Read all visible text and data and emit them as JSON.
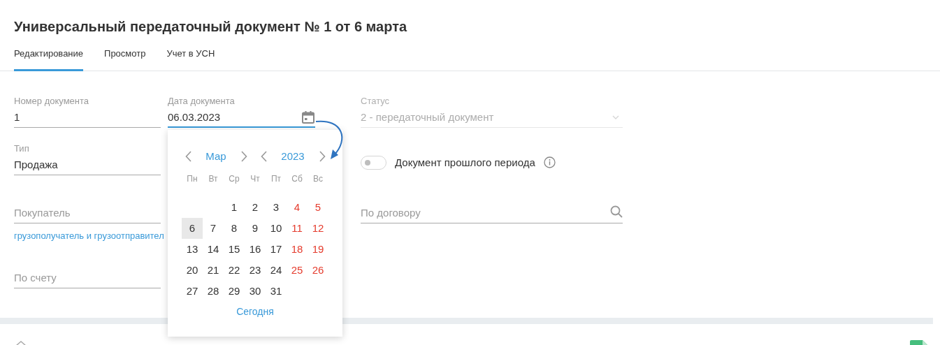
{
  "title": "Универсальный передаточный документ № 1 от 6 марта",
  "tabs": [
    {
      "label": "Редактирование",
      "selected": true
    },
    {
      "label": "Просмотр",
      "selected": false
    },
    {
      "label": "Учет в УСН",
      "selected": false
    }
  ],
  "columns": [
    {
      "fields": [
        {
          "kind": "text",
          "label": "Номер документа",
          "value": "1"
        },
        {
          "kind": "text",
          "label": "Тип",
          "value": "Продажа"
        },
        {
          "kind": "text",
          "placeholder": "Покупатель",
          "link": "грузополучатель и грузоотправител"
        },
        {
          "kind": "text",
          "placeholder": "По счету"
        }
      ]
    },
    {
      "fields": [
        {
          "kind": "date",
          "label": "Дата документа",
          "value": "06.03.2023",
          "focused": true
        }
      ]
    },
    {
      "fields": [
        {
          "kind": "select",
          "label": "Статус",
          "value": "2 - передаточный документ",
          "disabled": true
        },
        {
          "kind": "toggle",
          "label": "Документ прошлого периода",
          "on": false
        },
        {
          "kind": "search",
          "placeholder": "По договору"
        }
      ]
    }
  ],
  "calendar": {
    "month": "Мар",
    "year": "2023",
    "weekdays": [
      "Пн",
      "Вт",
      "Ср",
      "Чт",
      "Пт",
      "Сб",
      "Вс"
    ],
    "weeks": [
      {
        "days": [
          {
            "kind": "blank"
          },
          {
            "kind": "blank"
          },
          {
            "kind": "day",
            "day": "1",
            "weekend": false,
            "selected": false
          },
          {
            "kind": "day",
            "day": "2",
            "weekend": false,
            "selected": false
          },
          {
            "kind": "day",
            "day": "3",
            "weekend": false,
            "selected": false
          },
          {
            "kind": "day",
            "day": "4",
            "weekend": true,
            "selected": false
          },
          {
            "kind": "day",
            "day": "5",
            "weekend": true,
            "selected": false
          }
        ]
      },
      {
        "days": [
          {
            "kind": "day",
            "day": "6",
            "weekend": false,
            "selected": true
          },
          {
            "kind": "day",
            "day": "7",
            "weekend": false,
            "selected": false
          },
          {
            "kind": "day",
            "day": "8",
            "weekend": false,
            "selected": false
          },
          {
            "kind": "day",
            "day": "9",
            "weekend": false,
            "selected": false
          },
          {
            "kind": "day",
            "day": "10",
            "weekend": false,
            "selected": false
          },
          {
            "kind": "day",
            "day": "11",
            "weekend": true,
            "selected": false
          },
          {
            "kind": "day",
            "day": "12",
            "weekend": true,
            "selected": false
          }
        ]
      },
      {
        "days": [
          {
            "kind": "day",
            "day": "13",
            "weekend": false,
            "selected": false
          },
          {
            "kind": "day",
            "day": "14",
            "weekend": false,
            "selected": false
          },
          {
            "kind": "day",
            "day": "15",
            "weekend": false,
            "selected": false
          },
          {
            "kind": "day",
            "day": "16",
            "weekend": false,
            "selected": false
          },
          {
            "kind": "day",
            "day": "17",
            "weekend": false,
            "selected": false
          },
          {
            "kind": "day",
            "day": "18",
            "weekend": true,
            "selected": false
          },
          {
            "kind": "day",
            "day": "19",
            "weekend": true,
            "selected": false
          }
        ]
      },
      {
        "days": [
          {
            "kind": "day",
            "day": "20",
            "weekend": false,
            "selected": false
          },
          {
            "kind": "day",
            "day": "21",
            "weekend": false,
            "selected": false
          },
          {
            "kind": "day",
            "day": "22",
            "weekend": false,
            "selected": false
          },
          {
            "kind": "day",
            "day": "23",
            "weekend": false,
            "selected": false
          },
          {
            "kind": "day",
            "day": "24",
            "weekend": false,
            "selected": false
          },
          {
            "kind": "day",
            "day": "25",
            "weekend": true,
            "selected": false
          },
          {
            "kind": "day",
            "day": "26",
            "weekend": true,
            "selected": false
          }
        ]
      },
      {
        "days": [
          {
            "kind": "day",
            "day": "27",
            "weekend": false,
            "selected": false
          },
          {
            "kind": "day",
            "day": "28",
            "weekend": false,
            "selected": false
          },
          {
            "kind": "day",
            "day": "29",
            "weekend": false,
            "selected": false
          },
          {
            "kind": "day",
            "day": "30",
            "weekend": false,
            "selected": false
          },
          {
            "kind": "day",
            "day": "31",
            "weekend": false,
            "selected": false
          }
        ]
      }
    ],
    "today": "Сегодня"
  }
}
